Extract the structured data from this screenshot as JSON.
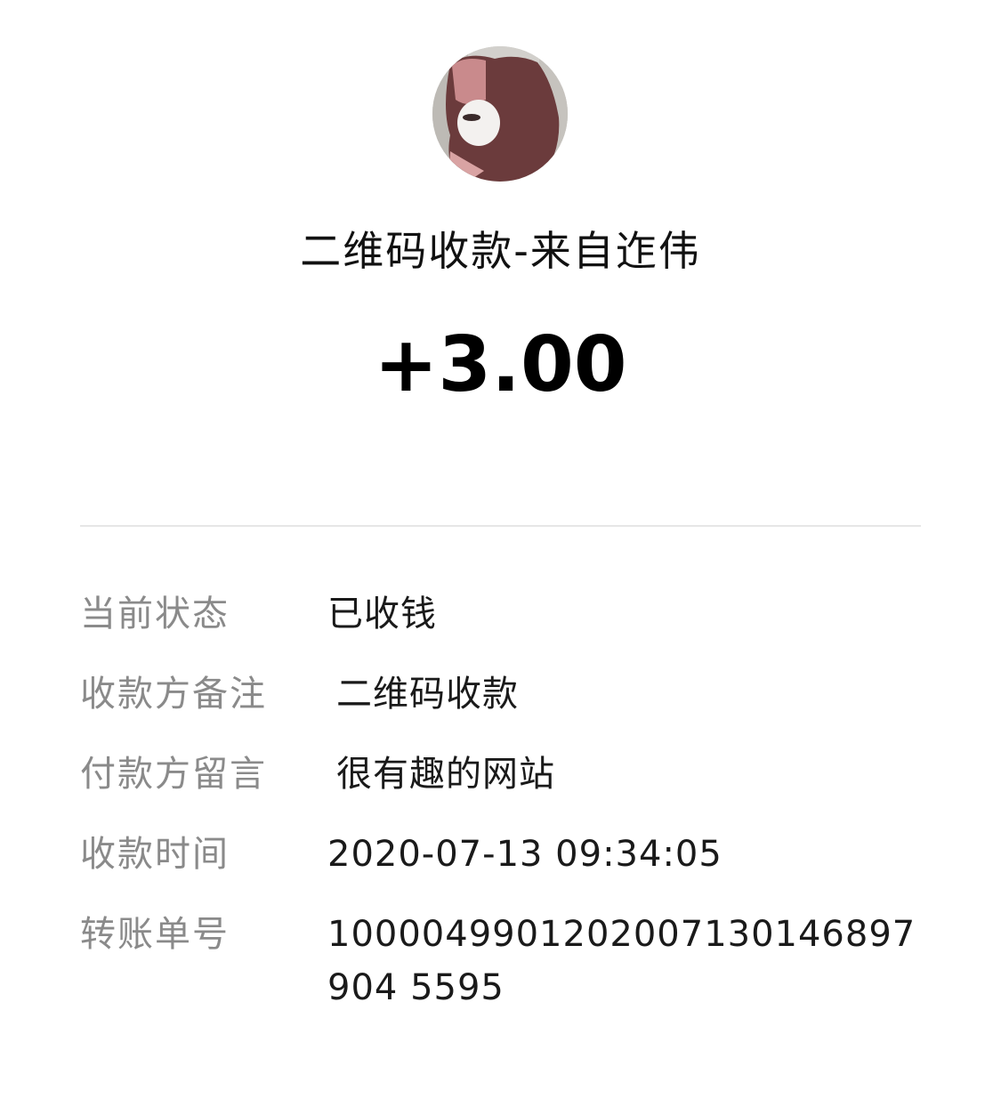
{
  "header": {
    "title": "二维码收款-来自迮伟",
    "amount": "+3.00"
  },
  "details": {
    "status_label": "当前状态",
    "status_value": "已收钱",
    "payee_note_label": "收款方备注",
    "payee_note_value": "二维码收款",
    "payer_message_label": "付款方留言",
    "payer_message_value": "很有趣的网站",
    "time_label": "收款时间",
    "time_value": "2020-07-13 09:34:05",
    "order_label": "转账单号",
    "order_value": "1000049901202007130146897904 5595"
  },
  "colors": {
    "label": "#8a8a8a",
    "value": "#1a1a1a",
    "divider": "#e6e6e6"
  }
}
